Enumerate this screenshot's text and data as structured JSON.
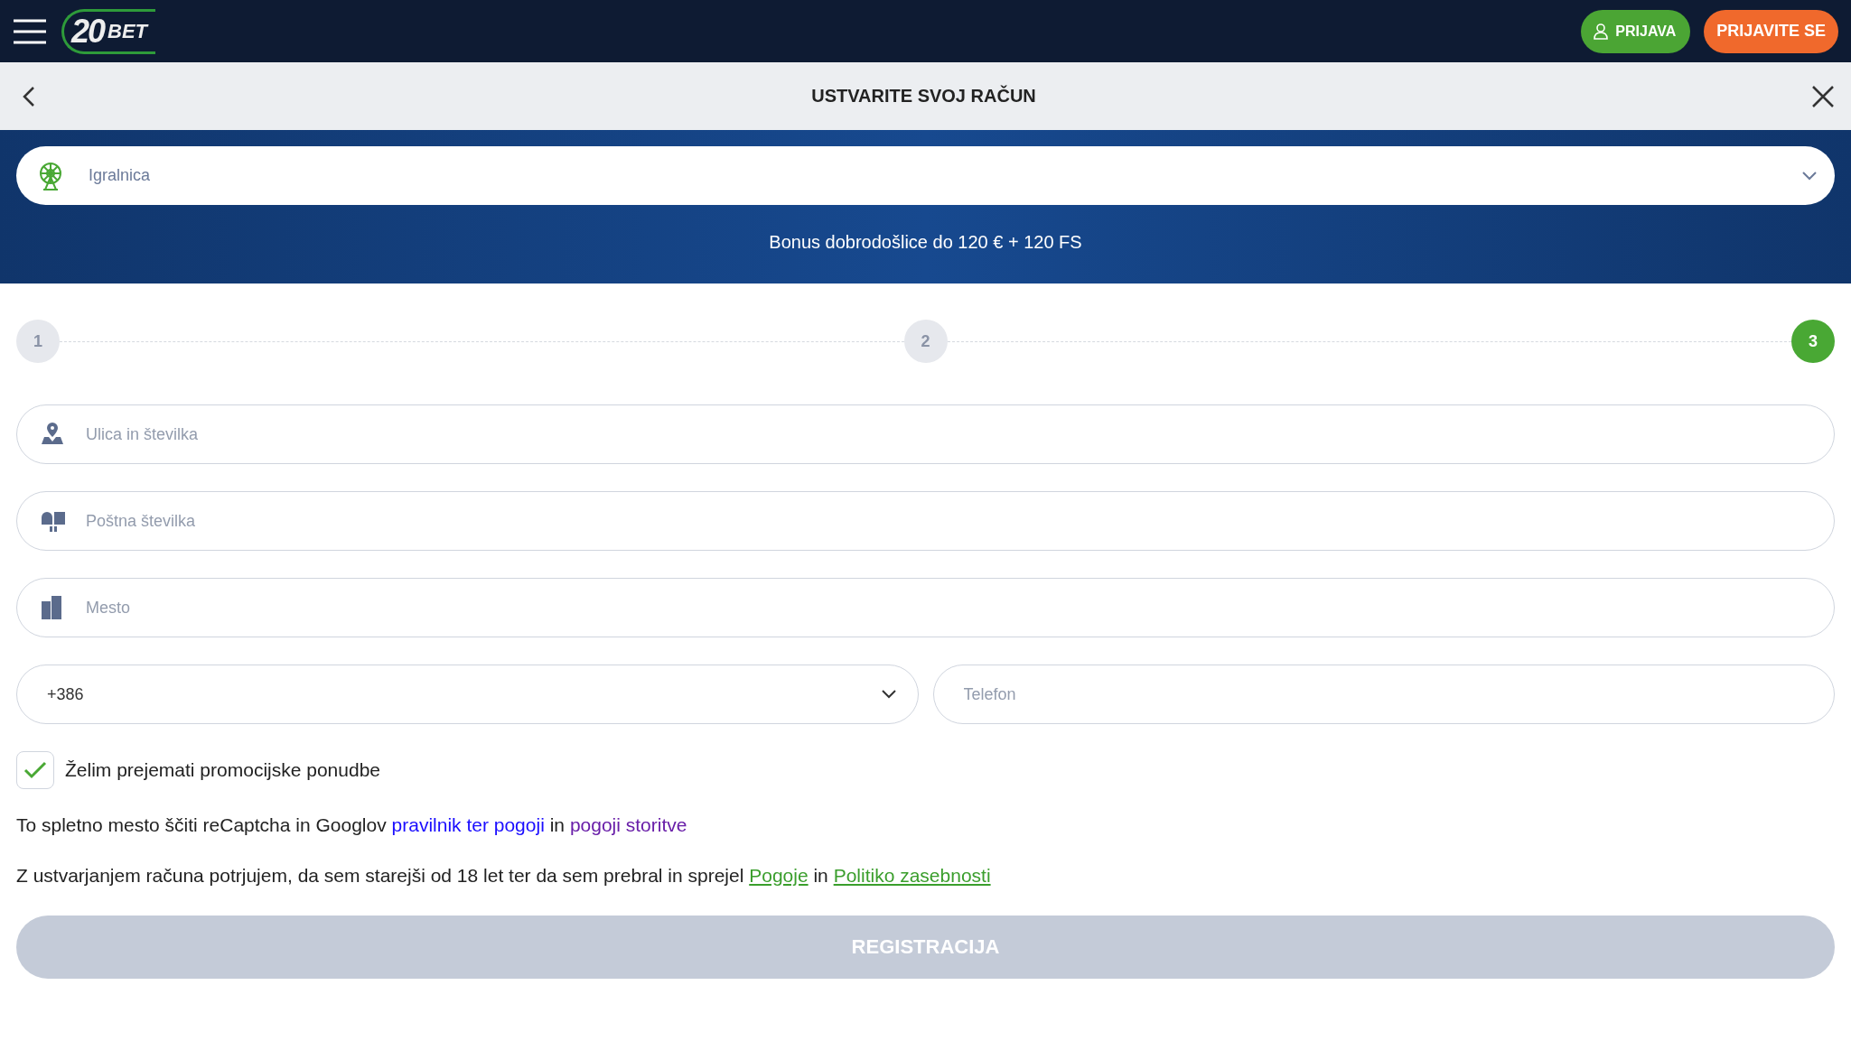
{
  "header": {
    "logo": {
      "number": "20",
      "word": "BET"
    },
    "login_button": "PRIJAVA",
    "signup_button": "PRIJAVITE SE"
  },
  "title_bar": {
    "title": "USTVARITE SVOJ RAČUN"
  },
  "banner": {
    "product_select": {
      "value": "Igralnica"
    },
    "bonus": "Bonus dobrodošlice do 120 € + 120 FS"
  },
  "steps": [
    {
      "label": "1",
      "selected": false
    },
    {
      "label": "2",
      "selected": false
    },
    {
      "label": "3",
      "selected": true
    }
  ],
  "fields": [
    {
      "kind": "street",
      "placeholder": "Ulica in številka"
    },
    {
      "kind": "postal",
      "placeholder": "Poštna številka"
    },
    {
      "kind": "city",
      "placeholder": "Mesto"
    }
  ],
  "phone": {
    "country_code": "+386",
    "placeholder": "Telefon"
  },
  "promo_checkbox": {
    "label": "Želim prejemati promocijske ponudbe",
    "checked": true
  },
  "legal_texts": [
    {
      "parts": [
        {
          "kind": "plain",
          "text": "To spletno mesto ščiti reCaptcha in Googlov"
        },
        {
          "kind": "link",
          "text": "pravilnik ter pogoji"
        },
        {
          "kind": "plain",
          "text": "in"
        },
        {
          "kind": "visited",
          "text": "pogoji storitve"
        }
      ]
    },
    {
      "parts": [
        {
          "kind": "plain",
          "text": "Z ustvarjanjem računa potrjujem, da sem starejši od 18 let ter da sem prebral in sprejel"
        },
        {
          "kind": "underlined",
          "text": "Pogoje"
        },
        {
          "kind": "plain",
          "text": "in"
        },
        {
          "kind": "underlined",
          "text": "Politiko zasebnosti"
        }
      ]
    }
  ],
  "register_button": {
    "label": "REGISTRACIJA",
    "disabled": true
  }
}
